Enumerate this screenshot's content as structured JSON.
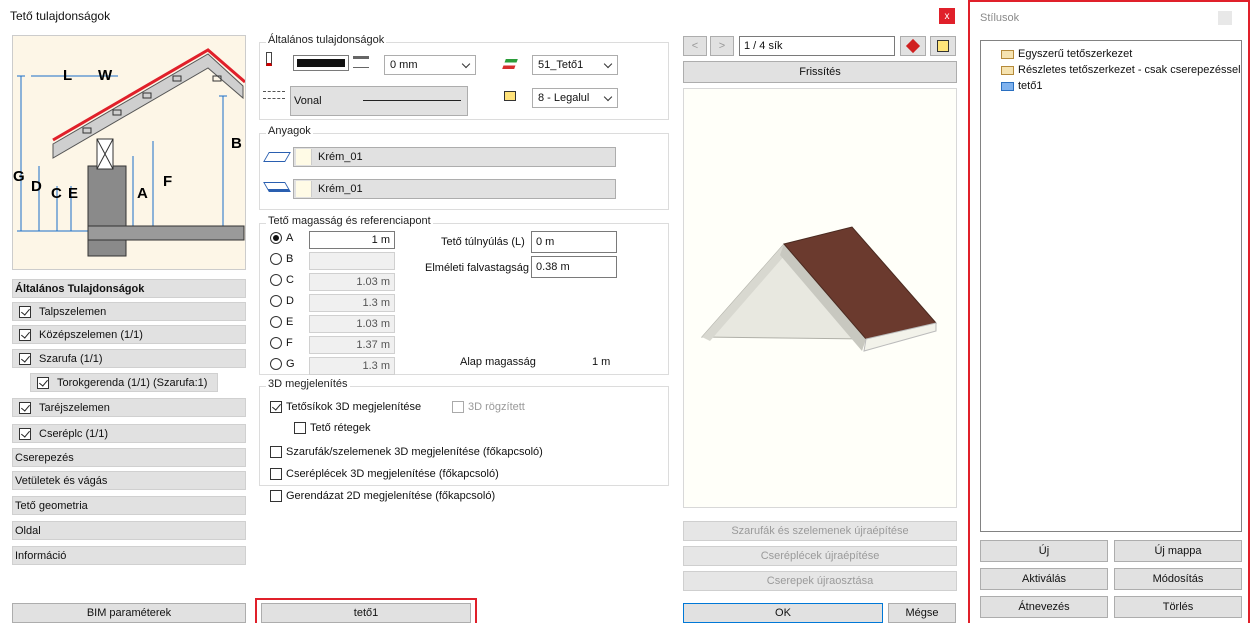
{
  "window": {
    "title": "Tető tulajdonságok",
    "close": "x"
  },
  "nav": {
    "header": "Általános Tulajdonságok",
    "items": [
      {
        "label": "Talpszelemen",
        "checked": true
      },
      {
        "label": "Középszelemen (1/1)",
        "checked": true
      },
      {
        "label": "Szarufa (1/1)",
        "checked": true
      },
      {
        "label": "Torokgerenda (1/1) (Szarufa:1)",
        "checked": true
      },
      {
        "label": "Taréjszelemen",
        "checked": true
      },
      {
        "label": "Cseréplc (1/1)",
        "checked": true
      }
    ],
    "plain": [
      "Cserepezés",
      "Vetületek és vágás",
      "Tető geometria",
      "Oldal",
      "Információ"
    ],
    "bim": "BIM paraméterek"
  },
  "diagram": {
    "L": "L",
    "W": "W",
    "B": "B",
    "G": "G",
    "D": "D",
    "C": "C",
    "E": "E",
    "A": "A",
    "F": "F"
  },
  "general": {
    "title": "Általános tulajdonságok",
    "thickness": "0 mm",
    "layer": "51_Tető1",
    "line_type": "Vonal",
    "draw_order": "8 - Legalul"
  },
  "materials": {
    "title": "Anyagok",
    "top": "Krém_01",
    "bottom": "Krém_01"
  },
  "height": {
    "title": "Tető magasság és referenciapont",
    "rows": [
      {
        "label": "A",
        "value": "1 m",
        "selected": true
      },
      {
        "label": "B",
        "value": ""
      },
      {
        "label": "C",
        "value": "1.03 m"
      },
      {
        "label": "D",
        "value": "1.3 m"
      },
      {
        "label": "E",
        "value": "1.03 m"
      },
      {
        "label": "F",
        "value": "1.37 m"
      },
      {
        "label": "G",
        "value": "1.3 m"
      }
    ],
    "overhang_label": "Tető túlnyúlás (L)",
    "overhang": "0 m",
    "wall_label": "Elméleti falvastagság",
    "wall": "0.38 m",
    "base_label": "Alap magasság",
    "base": "1 m"
  },
  "display3d": {
    "title": "3D megjelenítés",
    "planes": "Tetősíkok 3D megjelenítése",
    "fixed": "3D rögzített",
    "layers": "Tető rétegek",
    "rafters": "Szarufák/szelemenek 3D megjelenítése (főkapcsoló)",
    "battens": "Cseréplécek 3D megjelenítése (főkapcsoló)",
    "beams": "Gerendázat 2D megjelenítése (főkapcsoló)"
  },
  "preview": {
    "page": "1 / 4 sík",
    "refresh": "Frissítés",
    "rebuild_rafters": "Szarufák és szelemenek újraépítése",
    "rebuild_battens": "Cseréplécek újraépítése",
    "redistribute": "Cserepek újraosztása"
  },
  "name_field": "tető1",
  "ok": "OK",
  "cancel": "Mégse",
  "styles": {
    "title": "Stílusok",
    "tree": [
      "Egyszerű tetőszerkezet",
      "Részletes tetőszerkezet - csak cserepezéssel",
      "tető1"
    ],
    "new": "Új",
    "new_folder": "Új mappa",
    "activate": "Aktiválás",
    "modify": "Módosítás",
    "rename": "Átnevezés",
    "delete": "Törlés"
  },
  "colors": {
    "accent": "#e0202a",
    "ok_border": "#0078d7",
    "close_bg": "#e0202a",
    "roof": "#6b3a2e"
  }
}
